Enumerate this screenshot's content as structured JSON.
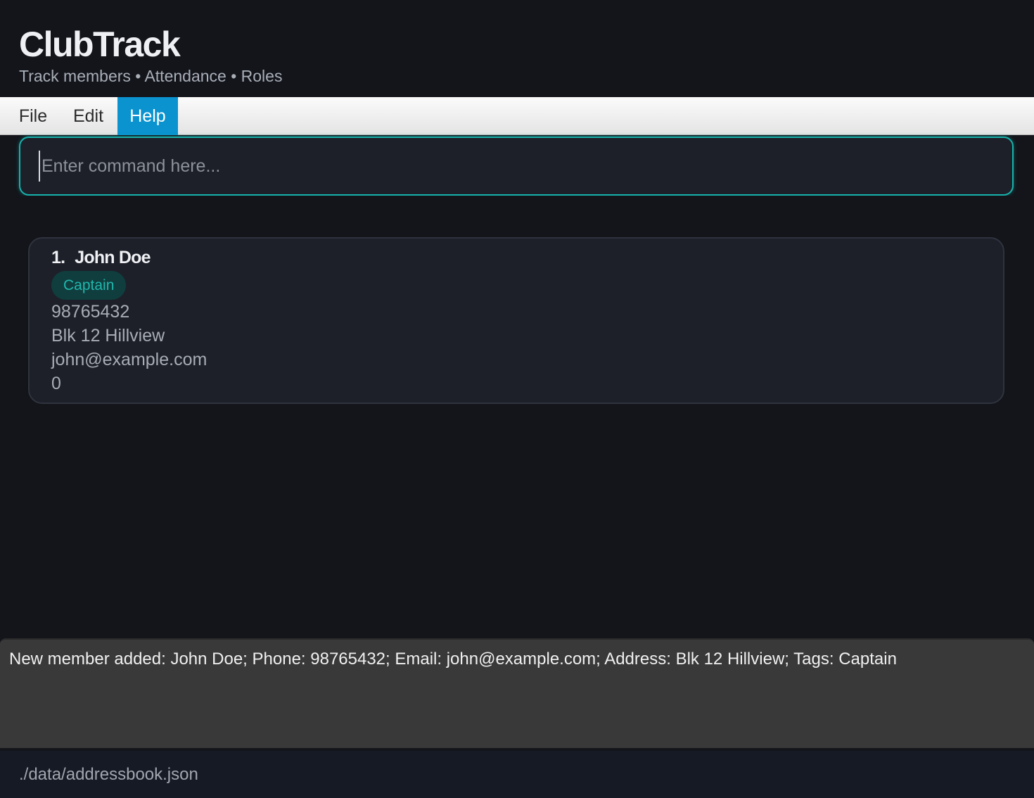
{
  "app": {
    "title": "ClubTrack",
    "subtitle": "Track members • Attendance • Roles"
  },
  "menu": {
    "items": [
      {
        "label": "File",
        "active": false
      },
      {
        "label": "Edit",
        "active": false
      },
      {
        "label": "Help",
        "active": true
      }
    ]
  },
  "command": {
    "value": "",
    "placeholder": "Enter command here..."
  },
  "members": [
    {
      "index": "1.",
      "name": "John Doe",
      "tags": [
        "Captain"
      ],
      "phone": "98765432",
      "address": "Blk 12 Hillview",
      "email": "john@example.com",
      "attendance": "0"
    }
  ],
  "result": {
    "message": "New member added: John Doe; Phone: 98765432; Email: john@example.com; Address: Blk 12 Hillview; Tags: Captain"
  },
  "status": {
    "file_path": "./data/addressbook.json"
  },
  "colors": {
    "background": "#13151b",
    "accent": "#17b3ac",
    "menu_active": "#0b93cf",
    "card": "#1d2029",
    "tag_bg": "#103e3e",
    "tag_text": "#1fb7ad",
    "result_bg": "#393939"
  }
}
